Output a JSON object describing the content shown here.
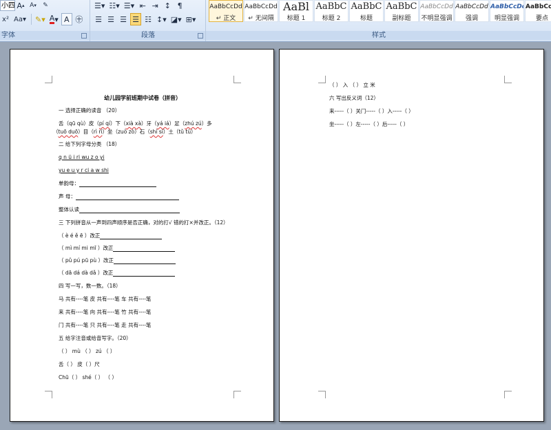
{
  "ribbon": {
    "font_size": "小四",
    "font_group_label": "字体",
    "paragraph_group_label": "段落",
    "styles_group_label": "样式",
    "styles": [
      {
        "sample": "AaBbCcDd",
        "name": "↵ 正文"
      },
      {
        "sample": "AaBbCcDd",
        "name": "↵ 无间隔"
      },
      {
        "sample": "AaBl",
        "name": "标题 1"
      },
      {
        "sample": "AaBbC",
        "name": "标题 2"
      },
      {
        "sample": "AaBbC",
        "name": "标题"
      },
      {
        "sample": "AaBbC",
        "name": "副标题"
      },
      {
        "sample": "AaBbCcDd",
        "name": "不明显强调"
      },
      {
        "sample": "AaBbCcDd",
        "name": "强调"
      },
      {
        "sample": "AaBbCcDd",
        "name": "明显强调"
      },
      {
        "sample": "AaBbCcDd",
        "name": "要点"
      }
    ]
  },
  "doc": {
    "title": "幼儿园学前班期中试卷（拼音）",
    "s1_head": "一 选择正确的读音 （20）",
    "s1_l1_a": "舌（qū qù）皮（",
    "s1_l1_b": "pí qí",
    "s1_l1_c": "）下（",
    "s1_l1_d": "xià xà",
    "s1_l1_e": "）牙（",
    "s1_l1_f": "yá iá",
    "s1_l1_g": "）足（",
    "s1_l1_h": "zhú zú",
    "s1_l1_i": "）多",
    "s1_l2_a": "（",
    "s1_l2_b": "tuō duō",
    "s1_l2_c": "）目（",
    "s1_l2_d": "rì rì",
    "s1_l2_e": "）坐（zuò zò）石（",
    "s1_l2_f": "shí sí",
    "s1_l2_g": "）土（tǔ tù）",
    "s2_head": "二 给下列字母分类 （18）",
    "s2_l1": "q n ü i ri wu z o yi",
    "s2_l2": "yu e u y r ci a w shi",
    "s2_shengmu1": "单韵母：",
    "s2_shengmu2": "声  母：",
    "s2_zhengti": "整体认读",
    "s3_head": "三 下列拼音从一声到四声顺序是否正确，对的打√ 错的打×并改正。（12）",
    "s3_l1": "（ è é ě ē ）改正",
    "s3_l2": "（ mì mí mi mī ）改正",
    "s3_l3": "（ pǔ pú pū pù ）改正",
    "s3_l4": "（ dā dá dà dǎ ）改正",
    "s4_head": "四 写一写，数一数。（18）",
    "s4_l1": "马 共有----笔  皮 共有----笔  车 共有----笔",
    "s4_l2": "来 共有----笔  向 共有----笔  竹 共有----笔",
    "s4_l3": "门 共有----笔  只 共有----笔  走 共有----笔",
    "s5_head": "五 给字注音或给音写字。（20）",
    "s5_l1": "（ ） mù （ ） zú （ ）",
    "s5_l2": "舌（ ）  皮（ ）尺",
    "s5_l3": "Chū（ ）  shé（ ）  （ ）",
    "p2_l1": "（ ） 入 （ ） 立 米",
    "p2_head": "六 写出反义词（12）",
    "p2_l2": "来-----（ ）关门-----（ ）入-----（ ）",
    "p2_l3": "坐-----（ ）左-----（ ）后-----（ ）"
  }
}
